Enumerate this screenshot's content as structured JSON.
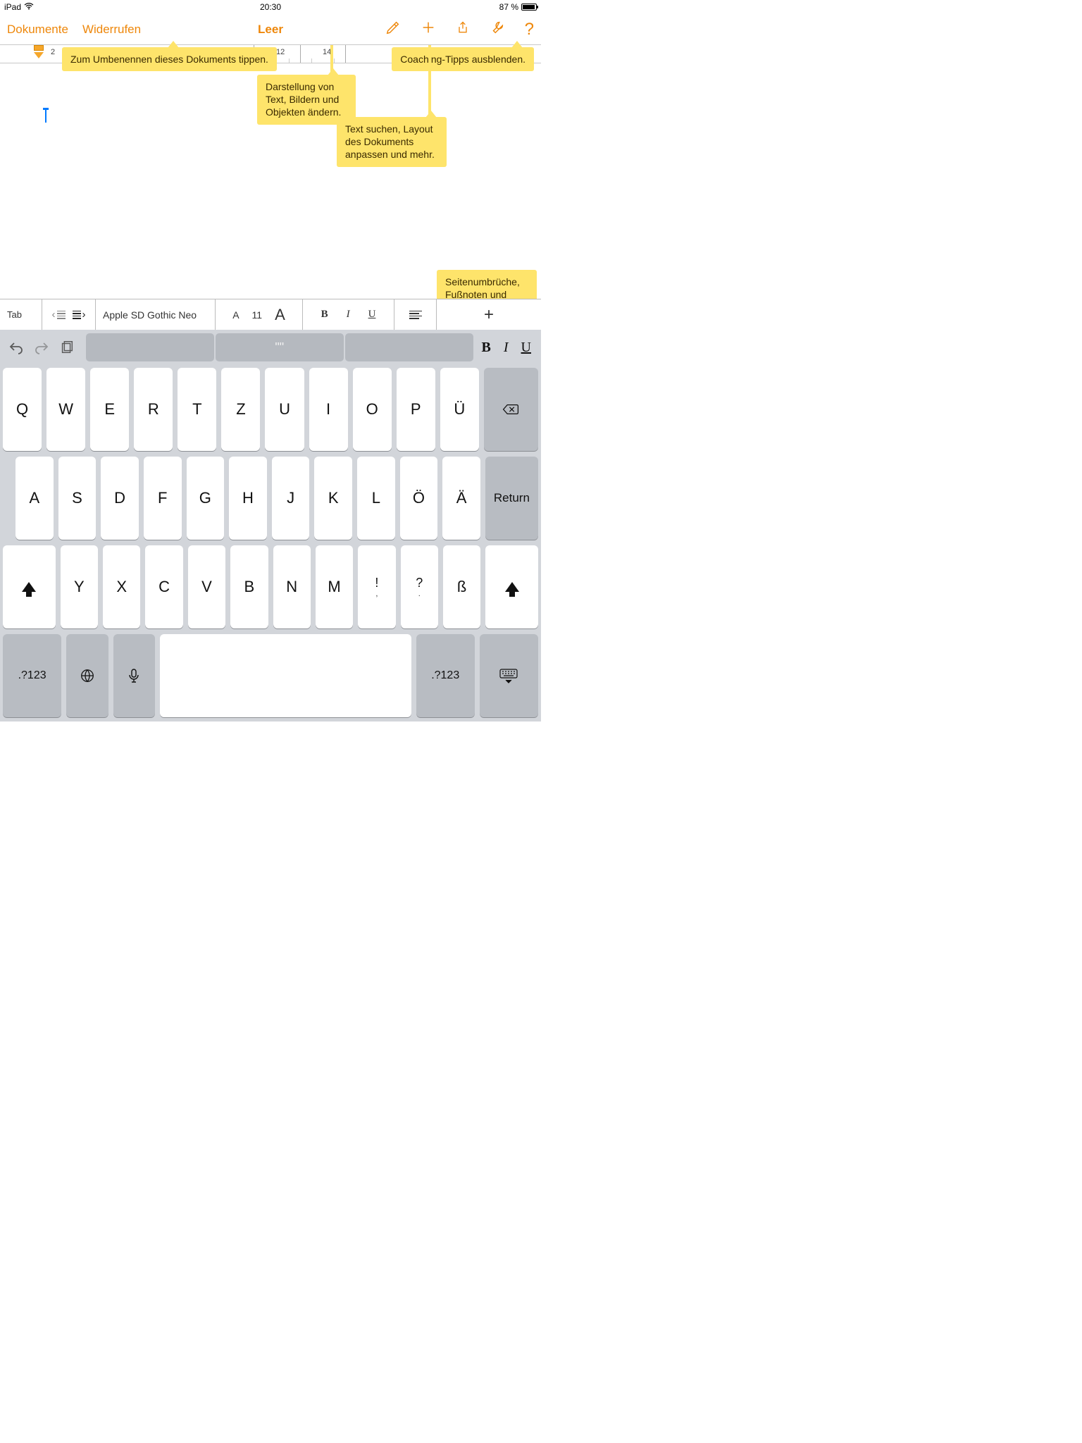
{
  "status": {
    "device": "iPad",
    "time": "20:30",
    "battery": "87 %"
  },
  "toolbar": {
    "documents": "Dokumente",
    "undo": "Widerrufen",
    "title": "Leer"
  },
  "ruler": {
    "labels": [
      "2",
      "12",
      "14"
    ]
  },
  "tips": {
    "rename": "Zum Umbenennen dieses Dokuments tippen.",
    "hide": "Coaching-Tipps ausblenden.",
    "format": "Darstellung von Text, Bildern und Objekten ändern.",
    "tools": "Text suchen, Layout des Dokuments anpassen und mehr.",
    "insert": "Seitenumbrüche, Fußnoten und mehr hinzufügen."
  },
  "formatbar": {
    "tab": "Tab",
    "font": "Apple SD Gothic Neo",
    "sizeSmall": "A",
    "sizeNum": "11",
    "sizeBig": "A",
    "bold": "B",
    "italic": "I",
    "underline": "U",
    "plus": "+"
  },
  "keyboard": {
    "suggestion_mid": "\"\"",
    "top_b": "B",
    "top_i": "I",
    "top_u": "U",
    "row1": [
      "Q",
      "W",
      "E",
      "R",
      "T",
      "Z",
      "U",
      "I",
      "O",
      "P",
      "Ü"
    ],
    "row2": [
      "A",
      "S",
      "D",
      "F",
      "G",
      "H",
      "J",
      "K",
      "L",
      "Ö",
      "Ä"
    ],
    "return": "Return",
    "row3": [
      "Y",
      "X",
      "C",
      "V",
      "B",
      "N",
      "M"
    ],
    "punct1_top": "!",
    "punct1_bot": ",",
    "punct2_top": "?",
    "punct2_bot": ".",
    "eszett": "ß",
    "numkey": ".?123"
  }
}
